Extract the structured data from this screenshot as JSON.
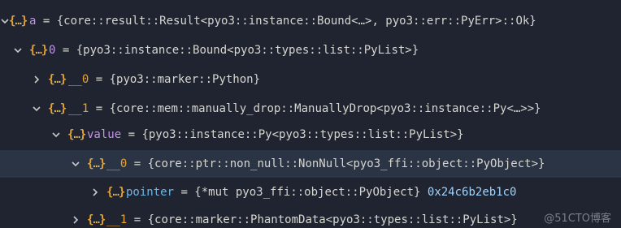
{
  "tree": {
    "rows": [
      {
        "name": "a",
        "value": " = {core::result::Result<pyo3::instance::Bound<…>, pyo3::err::PyErr>::Ok}",
        "expanded": true,
        "selected": false
      },
      {
        "name": "0",
        "value": " = {pyo3::instance::Bound<pyo3::types::list::PyList>}",
        "expanded": true,
        "selected": false
      },
      {
        "name": "__0",
        "value": " = {pyo3::marker::Python}",
        "expanded": false,
        "selected": false
      },
      {
        "name": "__1",
        "value": " = {core::mem::manually_drop::ManuallyDrop<pyo3::instance::Py<…>>}",
        "expanded": true,
        "selected": false
      },
      {
        "name": "value",
        "value": " = {pyo3::instance::Py<pyo3::types::list::PyList>}",
        "expanded": true,
        "selected": false
      },
      {
        "name": "__0",
        "value": " = {core::ptr::non_null::NonNull<pyo3_ffi::object::PyObject>}",
        "expanded": true,
        "selected": true
      },
      {
        "name": "pointer",
        "value": " = {*mut pyo3_ffi::object::PyObject} ",
        "hex": "0x24c6b2eb1c0",
        "expanded": false,
        "selected": false
      },
      {
        "name": "__1",
        "value": " = {core::marker::PhantomData<pyo3::types::list::PyList>}",
        "expanded": false,
        "selected": false
      }
    ],
    "icon_text": {
      "open": "{",
      "dots": "…",
      "close": "}"
    }
  },
  "watermark": "@51CTO博客",
  "colors": {
    "background": "#1f2430",
    "selected_row": "#2b3444",
    "name_orange": "#e6a533",
    "name_purple": "#c394e6",
    "name_blue": "#6fb5e6",
    "text": "#d6d6d0"
  }
}
